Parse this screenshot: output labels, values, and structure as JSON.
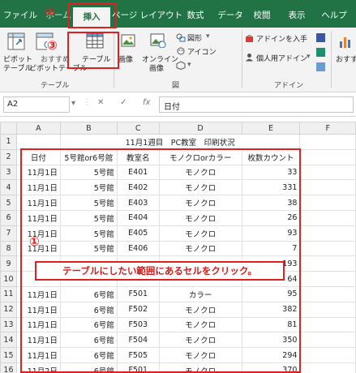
{
  "tabs": [
    "ファイル",
    "ホーム",
    "挿入",
    "ページ レイアウト",
    "数式",
    "データ",
    "校閲",
    "表示",
    "ヘルプ"
  ],
  "ribbon": {
    "pivot_label_1": "ピボット",
    "pivot_label_2": "テーブル",
    "recommended_label_1": "おすすめ",
    "recommended_label_2": "ピボットテーブル",
    "table_button": "テーブル",
    "table_group": "テーブル",
    "image": "画像",
    "online_image_1": "オンライン",
    "online_image_2": "画像",
    "shapes": "図形",
    "icons": "アイコン",
    "illustrations_group": "図",
    "get_addins": "アドインを入手",
    "personal_addins": "個人用アドイン",
    "addins_group": "アドイン",
    "recommended_chart": "おすす"
  },
  "formula_bar": {
    "name_box": "A2",
    "cancel": "✕",
    "enter": "✓",
    "fx": "fx",
    "value": "日付"
  },
  "sheet": {
    "columns": [
      "A",
      "B",
      "C",
      "D",
      "E",
      "F"
    ],
    "title": "11月1週目　PC教室　印刷状況",
    "headers": [
      "日付",
      "5号館or6号館",
      "教室名",
      "モノクロorカラー",
      "枚数カウント"
    ],
    "rows": [
      {
        "n": "3",
        "date": "11月1日",
        "bldg": "5号館",
        "room": "E401",
        "mode": "モノクロ",
        "count": "33"
      },
      {
        "n": "4",
        "date": "11月1日",
        "bldg": "5号館",
        "room": "E402",
        "mode": "モノクロ",
        "count": "331"
      },
      {
        "n": "5",
        "date": "11月1日",
        "bldg": "5号館",
        "room": "E403",
        "mode": "モノクロ",
        "count": "38"
      },
      {
        "n": "6",
        "date": "11月1日",
        "bldg": "5号館",
        "room": "E404",
        "mode": "モノクロ",
        "count": "26"
      },
      {
        "n": "7",
        "date": "11月1日",
        "bldg": "5号館",
        "room": "E405",
        "mode": "モノクロ",
        "count": "93"
      },
      {
        "n": "8",
        "date": "11月1日",
        "bldg": "5号館",
        "room": "E406",
        "mode": "モノクロ",
        "count": "7"
      },
      {
        "n": "9",
        "date": "",
        "bldg": "",
        "room": "",
        "mode": "",
        "count": "193"
      },
      {
        "n": "10",
        "date": "",
        "bldg": "",
        "room": "",
        "mode": "",
        "count": "64"
      },
      {
        "n": "11",
        "date": "11月1日",
        "bldg": "6号館",
        "room": "F501",
        "mode": "カラー",
        "count": "95"
      },
      {
        "n": "12",
        "date": "11月1日",
        "bldg": "6号館",
        "room": "F502",
        "mode": "モノクロ",
        "count": "382"
      },
      {
        "n": "13",
        "date": "11月1日",
        "bldg": "6号館",
        "room": "F503",
        "mode": "モノクロ",
        "count": "81"
      },
      {
        "n": "14",
        "date": "11月1日",
        "bldg": "6号館",
        "room": "F504",
        "mode": "モノクロ",
        "count": "350"
      },
      {
        "n": "15",
        "date": "11月1日",
        "bldg": "6号館",
        "room": "F505",
        "mode": "モノクロ",
        "count": "294"
      },
      {
        "n": "16",
        "date": "11月2日",
        "bldg": "6号館",
        "room": "F501",
        "mode": "モノクロ",
        "count": "370"
      }
    ]
  },
  "annotations": {
    "step1": "①",
    "step2": "②",
    "step3": "③",
    "callout": "テーブルにしたい範囲にあるセルをクリック。"
  },
  "colors": {
    "excel_green": "#217346",
    "annotation_red": "#e02020"
  }
}
